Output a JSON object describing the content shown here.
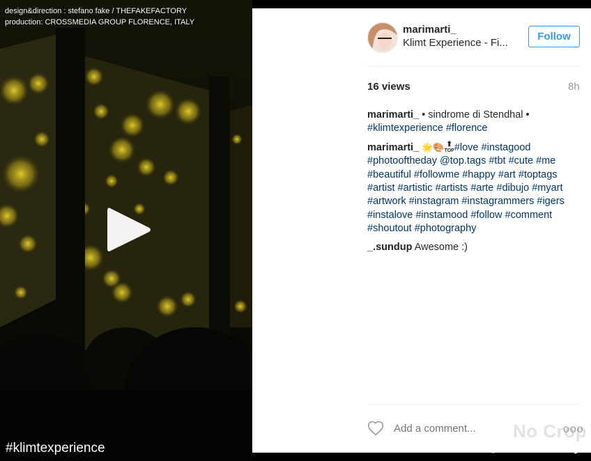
{
  "video": {
    "credit_line_1": "design&direction : stefano fake / THEFAKEFACTORY",
    "credit_line_2": "production: CROSSMEDIA GROUP FLORENCE, ITALY",
    "bottom_hashtag": "#klimtexperience",
    "watermark_left": "No Crop",
    "watermark_right": "@thefakefactory"
  },
  "post": {
    "username": "marimarti_",
    "location": "Klimt Experience - Fi...",
    "follow_label": "Follow",
    "views": "16 views",
    "time": "8h",
    "comments": [
      {
        "user": "marimarti_",
        "text": "• sindrome di Stendhal •",
        "tags": [
          "#klimtexperience",
          "#florence"
        ]
      },
      {
        "user": "marimarti_",
        "emojis": "🌟🎨",
        "top_icon": "⬆",
        "top_label": "TOP",
        "tags": [
          "#love",
          "#instagood",
          "#photooftheday",
          "@top.tags",
          "#tbt",
          "#cute",
          "#me",
          "#beautiful",
          "#followme",
          "#happy",
          "#art",
          "#toptags",
          "#artist",
          "#artistic",
          "#artists",
          "#arte",
          "#dibujo",
          "#myart",
          "#artwork",
          "#instagram",
          "#instagrammers",
          "#igers",
          "#instalove",
          "#instamood",
          "#follow",
          "#comment",
          "#shoutout",
          "#photography"
        ]
      },
      {
        "user": "_.sundup",
        "text": "Awesome :)"
      }
    ],
    "add_comment_placeholder": "Add a comment...",
    "more_label": "ooo"
  },
  "colors": {
    "link": "#003569",
    "follow_blue": "#3897f0",
    "muted": "#999999",
    "text": "#262626"
  },
  "icons": [
    "play-icon",
    "heart-icon",
    "more-options-icon"
  ]
}
